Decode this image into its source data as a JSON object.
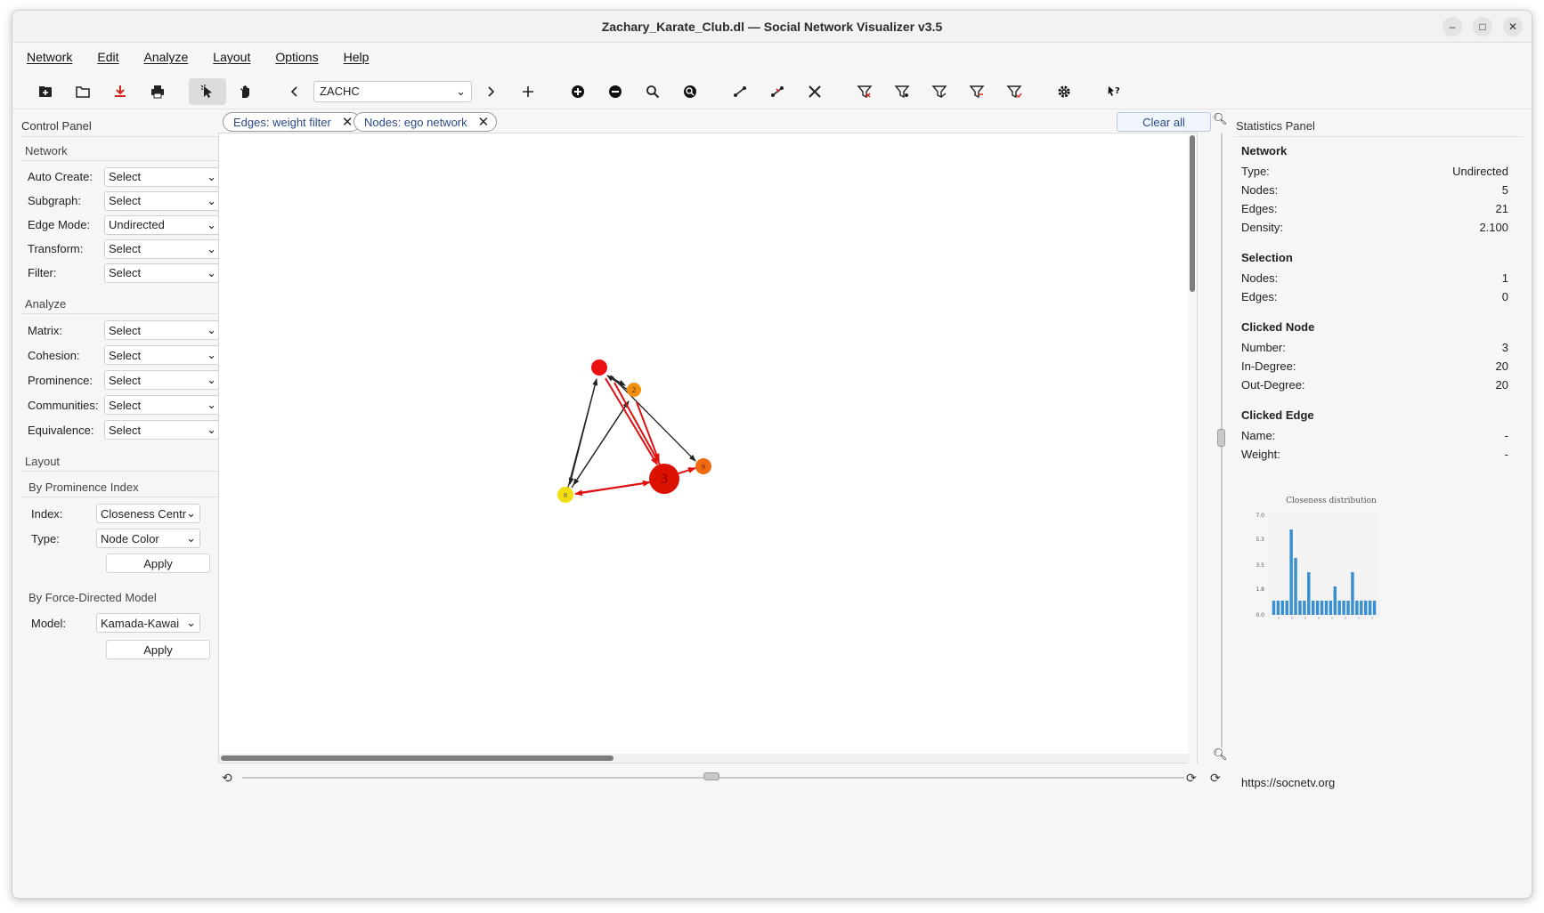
{
  "window": {
    "title": "Zachary_Karate_Club.dl — Social Network Visualizer v3.5",
    "controls": {
      "minimize": "–",
      "maximize": "□",
      "close": "✕"
    }
  },
  "menu": [
    "Network",
    "Edit",
    "Analyze",
    "Layout",
    "Options",
    "Help"
  ],
  "toolbar": {
    "dataset": "ZACHC",
    "icons": [
      "new-network-icon",
      "open-folder-icon",
      "save-icon",
      "print-icon",
      "select-mode-icon",
      "pan-mode-icon",
      "prev-icon",
      "next-icon",
      "add-icon",
      "add-node-icon",
      "remove-node-icon",
      "find-node-icon",
      "zoom-reset-icon",
      "add-edge-icon",
      "remove-edge-icon",
      "tools-icon",
      "filter-nodes-icon",
      "filter-isolates-icon",
      "filter-edges-icon",
      "filter-unilateral-icon",
      "filter-weight-icon",
      "settings-icon",
      "help-icon"
    ]
  },
  "control_panel": {
    "title": "Control Panel",
    "network": {
      "title": "Network",
      "rows": [
        {
          "label": "Auto Create:",
          "value": "Select"
        },
        {
          "label": "Subgraph:",
          "value": "Select"
        },
        {
          "label": "Edge Mode:",
          "value": "Undirected"
        },
        {
          "label": "Transform:",
          "value": "Select"
        },
        {
          "label": "Filter:",
          "value": "Select"
        }
      ]
    },
    "analyze": {
      "title": "Analyze",
      "rows": [
        {
          "label": "Matrix:",
          "value": "Select"
        },
        {
          "label": "Cohesion:",
          "value": "Select"
        },
        {
          "label": "Prominence:",
          "value": "Select"
        },
        {
          "label": "Communities:",
          "value": "Select"
        },
        {
          "label": "Equivalence:",
          "value": "Select"
        }
      ]
    },
    "layout": {
      "title": "Layout",
      "prominence": {
        "title": "By Prominence Index",
        "index_label": "Index:",
        "index_value": "Closeness Centrality",
        "type_label": "Type:",
        "type_value": "Node Color",
        "apply": "Apply"
      },
      "force": {
        "title": "By Force-Directed Model",
        "model_label": "Model:",
        "model_value": "Kamada-Kawai",
        "apply": "Apply"
      }
    }
  },
  "filters": {
    "chips": [
      "Edges: weight filter",
      "Nodes: ego network"
    ],
    "clear_all": "Clear all"
  },
  "graph": {
    "nodes": [
      {
        "id": "n1",
        "label": "",
        "color": "#ee1111",
        "r": 9
      },
      {
        "id": "n2",
        "label": "2",
        "color": "#f09010",
        "r": 8
      },
      {
        "id": "n3",
        "label": "3",
        "color": "#dd1100",
        "r": 17
      },
      {
        "id": "n9",
        "label": "9",
        "color": "#f06a10",
        "r": 9
      },
      {
        "id": "n8",
        "label": "8",
        "color": "#f2dd10",
        "r": 9
      }
    ]
  },
  "stats": {
    "title": "Statistics Panel",
    "network": {
      "title": "Network",
      "rows": [
        {
          "label": "Type:",
          "value": "Undirected"
        },
        {
          "label": "Nodes:",
          "value": "5"
        },
        {
          "label": "Edges:",
          "value": "21"
        },
        {
          "label": "Density:",
          "value": "2.100"
        }
      ]
    },
    "selection": {
      "title": "Selection",
      "rows": [
        {
          "label": "Nodes:",
          "value": "1"
        },
        {
          "label": "Edges:",
          "value": "0"
        }
      ]
    },
    "clicked_node": {
      "title": "Clicked Node",
      "rows": [
        {
          "label": "Number:",
          "value": "3"
        },
        {
          "label": "In-Degree:",
          "value": "20"
        },
        {
          "label": "Out-Degree:",
          "value": "20"
        }
      ]
    },
    "clicked_edge": {
      "title": "Clicked Edge",
      "rows": [
        {
          "label": "Name:",
          "value": "-"
        },
        {
          "label": "Weight:",
          "value": "-"
        }
      ]
    },
    "url": "https://socnetv.org"
  },
  "chart_data": {
    "type": "bar",
    "title": "Closeness distribution",
    "ylim": [
      0,
      7.0
    ],
    "yticks": [
      "7.0",
      "5.3",
      "3.5",
      "1.8",
      "0.0"
    ],
    "values": [
      1,
      1,
      1,
      1,
      6,
      4,
      1,
      1,
      3,
      1,
      1,
      1,
      1,
      1,
      2,
      1,
      1,
      1,
      3,
      1,
      1,
      1,
      1,
      1
    ],
    "color": "#3a8fd0"
  }
}
